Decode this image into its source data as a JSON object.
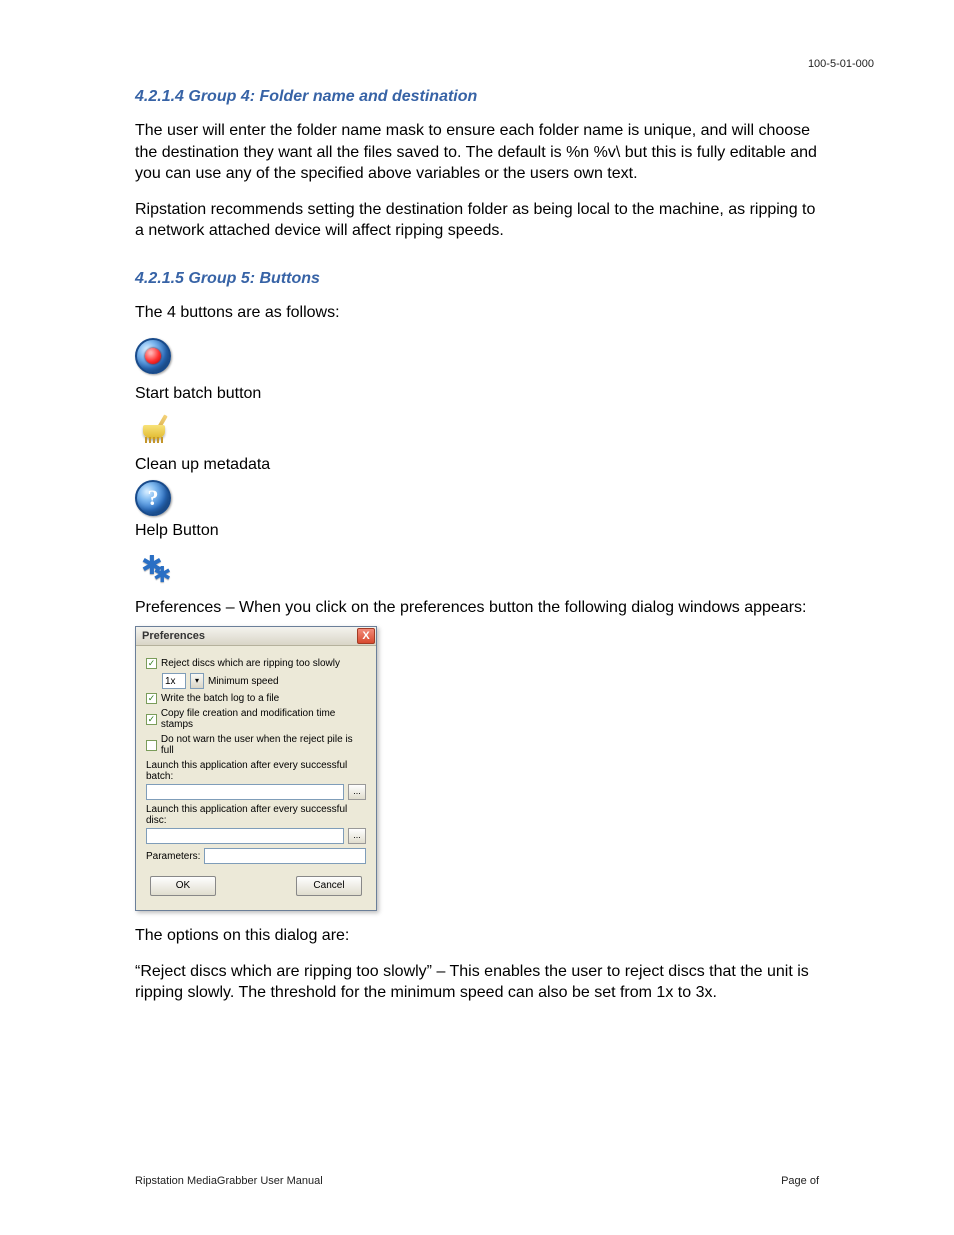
{
  "doc_id": "100-5-01-000",
  "section4_heading": "4.2.1.4 Group 4:  Folder name and destination",
  "section4_p1": "The user will enter the folder name mask to ensure each folder name is unique, and will choose the destination they want all the files saved to.  The default is %n %v\\ but this is fully editable and you can use any of the specified above variables or the users own text.",
  "section4_p2": "Ripstation recommends setting the destination folder as being local to the machine, as ripping to a network attached device will affect ripping speeds.",
  "section5_heading": "4.2.1.5 Group 5:  Buttons",
  "section5_intro": "The 4 buttons are as follows:",
  "btn1_caption": "Start batch button",
  "btn2_caption": "Clean up metadata",
  "btn3_caption": "Help Button",
  "btn4_caption": "Preferences – When you click on the preferences button the following dialog windows appears:",
  "help_glyph": "?",
  "dialog": {
    "title": "Preferences",
    "close_glyph": "X",
    "chk1": "Reject discs which are ripping too slowly",
    "speed_value": "1x",
    "speed_label": "Minimum speed",
    "chk2": "Write the batch log to a file",
    "chk3": "Copy file creation and modification time stamps",
    "chk4": "Do not warn the user when the reject pile is full",
    "launch_batch_label": "Launch this application after every successful batch:",
    "launch_disc_label": "Launch this application after every successful disc:",
    "browse_glyph": "...",
    "params_label": "Parameters:",
    "ok": "OK",
    "cancel": "Cancel"
  },
  "after_dialog_p1": "The options on this dialog are:",
  "after_dialog_p2": "“Reject discs which are ripping too slowly” – This enables the user to reject discs that the unit is ripping slowly. The threshold for the minimum speed can also be set from 1x to 3x.",
  "footer_left": "Ripstation MediaGrabber User Manual",
  "footer_right": "Page     of"
}
